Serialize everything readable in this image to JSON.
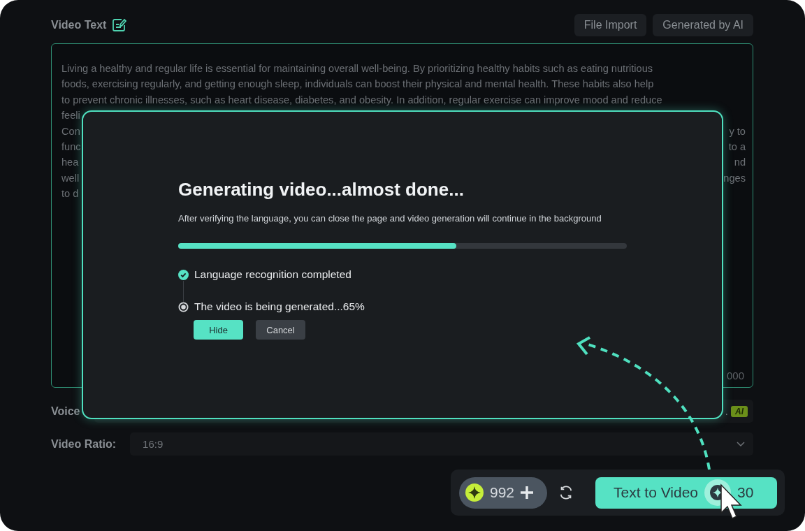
{
  "video_text": {
    "title": "Video Text",
    "buttons": [
      "File Import",
      "Generated by AI"
    ],
    "lines": [
      {
        "kind": "full",
        "text": "Living a healthy and regular life is essential for maintaining overall well-being. By prioritizing healthy habits such as eating nutritious"
      },
      {
        "kind": "full",
        "text": "foods, exercising regularly, and getting enough sleep, individuals can boost their physical and mental health. These habits also help"
      },
      {
        "kind": "full",
        "text": "to prevent chronic illnesses, such as heart disease, diabetes, and obesity. In addition, regular exercise can improve mood and reduce"
      },
      {
        "kind": "split",
        "left": "feeli"
      },
      {
        "kind": "split",
        "left": "Con",
        "right": "y to"
      },
      {
        "kind": "split",
        "left": "func",
        "right": "to a"
      },
      {
        "kind": "split",
        "left": "hea",
        "right": "nd"
      },
      {
        "kind": "split",
        "left": "well",
        "right": "nges"
      },
      {
        "kind": "split",
        "left": "to d"
      }
    ],
    "counter": "000"
  },
  "voice": {
    "label": "Voice",
    "value_tail": ".",
    "badge": "AI"
  },
  "ratio": {
    "label": "Video Ratio:",
    "value": "16:9"
  },
  "modal": {
    "title": "Generating video...almost done...",
    "subtitle": "After verifying the language, you can close the page and video generation will continue in the background",
    "level": 0.62,
    "steps": [
      {
        "label": "Language recognition completed",
        "done": true
      },
      {
        "label": "The video is being generated...65%",
        "done": false
      }
    ],
    "buttons": [
      {
        "label": "Hide",
        "kind": "primary"
      },
      {
        "label": "Cancel",
        "kind": "secondary"
      }
    ]
  },
  "footer": {
    "credits": "992",
    "action": "Text to Video",
    "cost": "30"
  }
}
